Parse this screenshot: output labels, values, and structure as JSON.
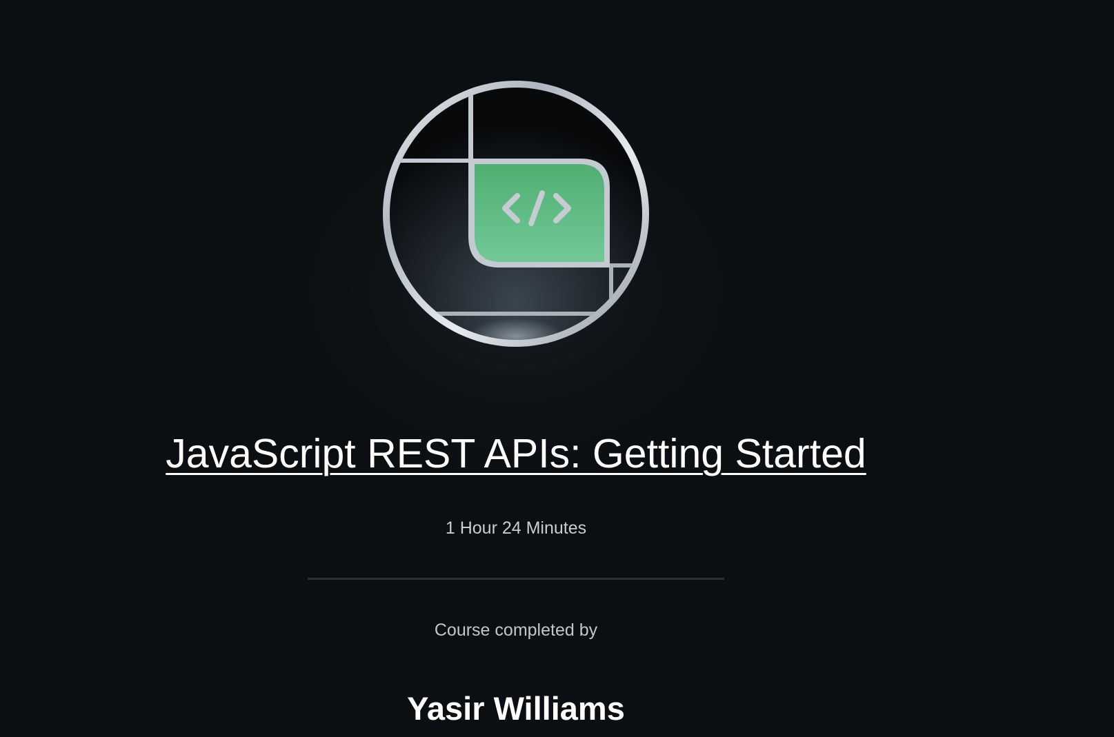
{
  "badge": {
    "icon": "code-brackets-icon",
    "accent_color": "#5fbf82"
  },
  "course": {
    "title": "JavaScript REST APIs: Getting Started",
    "duration": "1 Hour 24 Minutes"
  },
  "completion": {
    "label": "Course completed by",
    "learner_name": "Yasir Williams"
  }
}
